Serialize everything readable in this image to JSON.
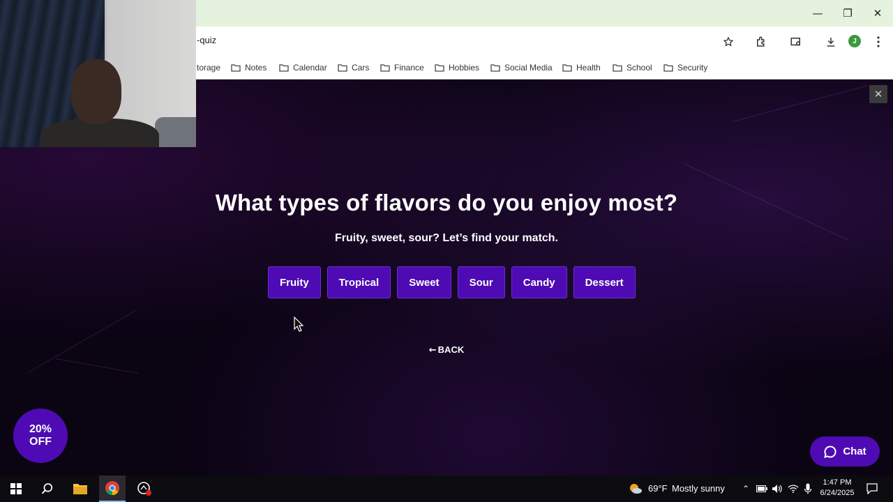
{
  "browser": {
    "url": "-quiz",
    "bookmarks": [
      "torage",
      "Notes",
      "Calendar",
      "Cars",
      "Finance",
      "Hobbies",
      "Social Media",
      "Health",
      "School",
      "Security"
    ],
    "profile_initial": "J"
  },
  "quiz": {
    "question": "What types of flavors do you enjoy most?",
    "subtitle": "Fruity, sweet, sour? Let’s find your match.",
    "options": [
      "Fruity",
      "Tropical",
      "Sweet",
      "Sour",
      "Candy",
      "Dessert"
    ],
    "back_label": "BACK",
    "accent_color": "#4e0bb3"
  },
  "promo": {
    "line1": "20%",
    "line2": "OFF"
  },
  "chat": {
    "label": "Chat"
  },
  "taskbar": {
    "weather_temp": "69°F",
    "weather_desc": "Mostly sunny",
    "time": "1:47 PM",
    "date": "6/24/2025"
  }
}
